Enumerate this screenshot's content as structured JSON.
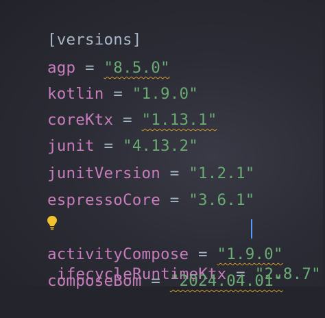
{
  "editor": {
    "section": "[versions]",
    "entries": [
      {
        "key": "agp",
        "eq": " = ",
        "value": "\"8.5.0\"",
        "warning": true
      },
      {
        "key": "kotlin",
        "eq": " = ",
        "value": "\"1.9.0\"",
        "warning": false
      },
      {
        "key": "coreKtx",
        "eq": " = ",
        "value": "\"1.13.1\"",
        "warning": true
      },
      {
        "key": "junit",
        "eq": " = ",
        "value": "\"4.13.2\"",
        "warning": false
      },
      {
        "key": "junitVersion",
        "eq": " = ",
        "value": "\"1.2.1\"",
        "warning": false
      },
      {
        "key": "espressoCore",
        "eq": " = ",
        "value": "\"3.6.1\"",
        "warning": false
      },
      {
        "key_suffix": "ifecycleRuntimeKtx",
        "key": "lifecycleRuntimeKtx",
        "eq": " = ",
        "value": "\"2.8.7\"",
        "warning": false
      },
      {
        "key": "activityCompose",
        "eq": " = ",
        "value": "\"1.9.0\"",
        "warning": true
      },
      {
        "key": "composeBom",
        "eq": " = ",
        "value": "\"2024.04.01\"",
        "warning": true
      }
    ],
    "icons": {
      "intention": "lightbulb-icon"
    },
    "colors": {
      "background": "#2b2c35",
      "key": "#c77dbb",
      "string": "#6aab73",
      "plain": "#a9b7c6",
      "warning_underline": "#d29a2a",
      "caret": "#5a9bff"
    }
  }
}
